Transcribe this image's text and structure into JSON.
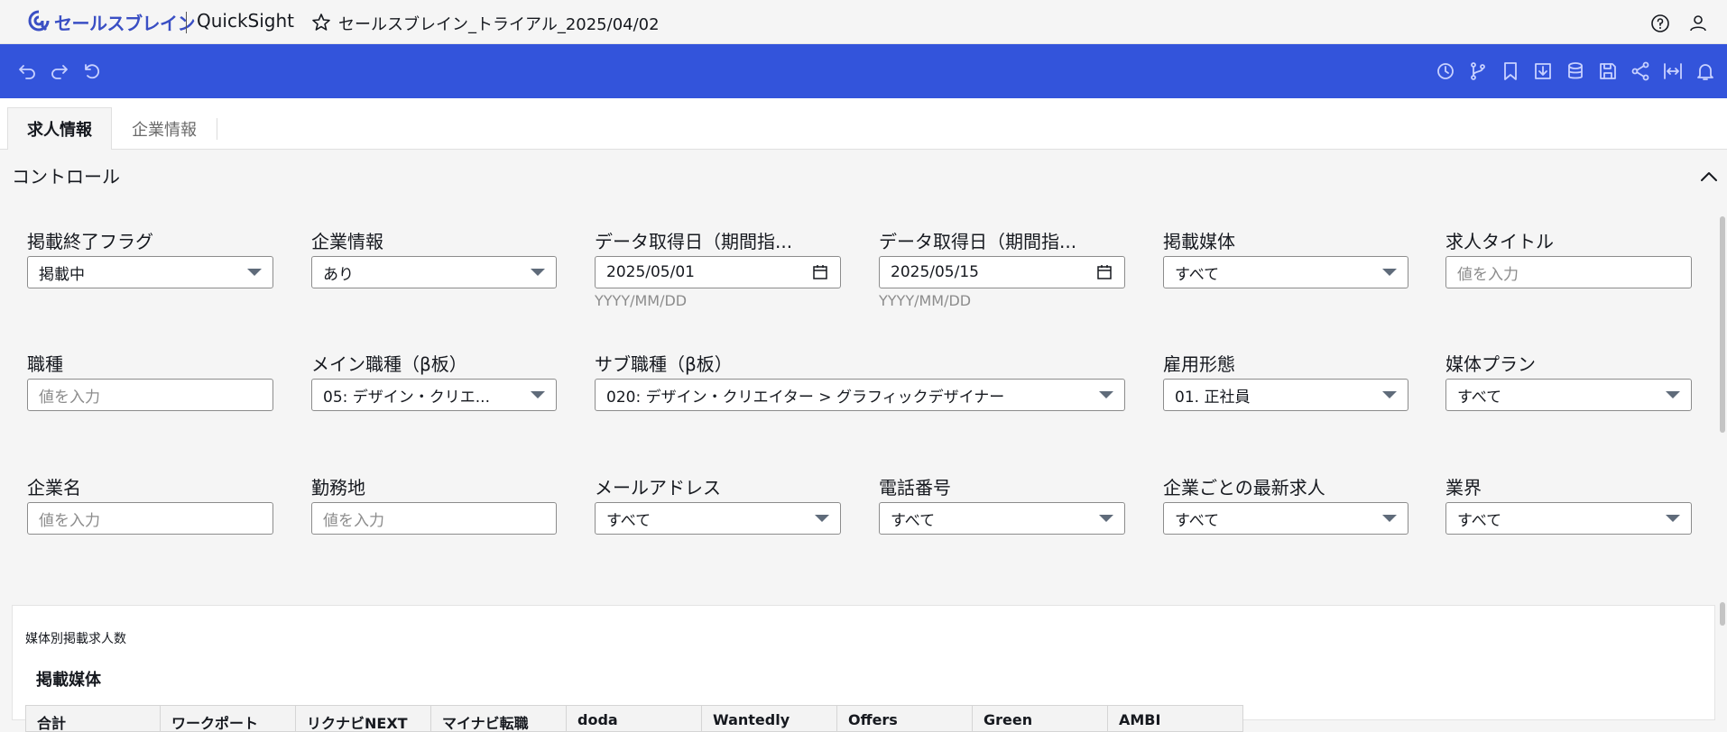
{
  "app": {
    "brand_name": "セールスブレイン",
    "product_name": "QuickSight",
    "analysis_title": "セールスブレイン_トライアル_2025/04/02",
    "brand_color": "#3a4fc4"
  },
  "toolbar": {
    "color": "#3354db",
    "left_icons": [
      "undo-icon",
      "redo-icon",
      "reset-icon"
    ],
    "right_icons": [
      "clock-icon",
      "branch-icon",
      "bookmark-icon",
      "export-icon",
      "dataset-icon",
      "save-icon",
      "share-icon",
      "fit-width-icon",
      "bell-icon"
    ]
  },
  "tabs": [
    {
      "label": "求人情報",
      "active": true
    },
    {
      "label": "企業情報",
      "active": false
    }
  ],
  "controls": {
    "title": "コントロール",
    "items": [
      {
        "label": "掲載終了フラグ",
        "type": "dropdown",
        "value": "掲載中"
      },
      {
        "label": "企業情報",
        "type": "dropdown",
        "value": "あり"
      },
      {
        "label": "データ取得日（期間指...",
        "type": "date",
        "value": "2025/05/01",
        "hint": "YYYY/MM/DD"
      },
      {
        "label": "データ取得日（期間指...",
        "type": "date",
        "value": "2025/05/15",
        "hint": "YYYY/MM/DD"
      },
      {
        "label": "掲載媒体",
        "type": "dropdown",
        "value": "すべて"
      },
      {
        "label": "求人タイトル",
        "type": "text",
        "placeholder": "値を入力"
      },
      {
        "label": "職種",
        "type": "text",
        "placeholder": "値を入力"
      },
      {
        "label": "メイン職種（β板）",
        "type": "dropdown",
        "value": "05: デザイン・クリエ..."
      },
      {
        "label": "サブ職種（β板）",
        "type": "dropdown",
        "value": "020: デザイン・クリエイター > グラフィックデザイナー"
      },
      {
        "label": "雇用形態",
        "type": "dropdown",
        "value": "01. 正社員"
      },
      {
        "label": "媒体プラン",
        "type": "dropdown",
        "value": "すべて"
      },
      {
        "label": "企業名",
        "type": "text",
        "placeholder": "値を入力"
      },
      {
        "label": "勤務地",
        "type": "text",
        "placeholder": "値を入力"
      },
      {
        "label": "メールアドレス",
        "type": "dropdown",
        "value": "すべて"
      },
      {
        "label": "電話番号",
        "type": "dropdown",
        "value": "すべて"
      },
      {
        "label": "企業ごとの最新求人",
        "type": "dropdown",
        "value": "すべて"
      },
      {
        "label": "業界",
        "type": "dropdown",
        "value": "すべて"
      }
    ]
  },
  "visual": {
    "title": "媒体別掲載求人数",
    "field_title": "掲載媒体",
    "columns": [
      "合計",
      "ワークポート",
      "リクナビNEXT",
      "マイナビ転職",
      "doda",
      "Wantedly",
      "Offers",
      "Green",
      "AMBI"
    ]
  }
}
